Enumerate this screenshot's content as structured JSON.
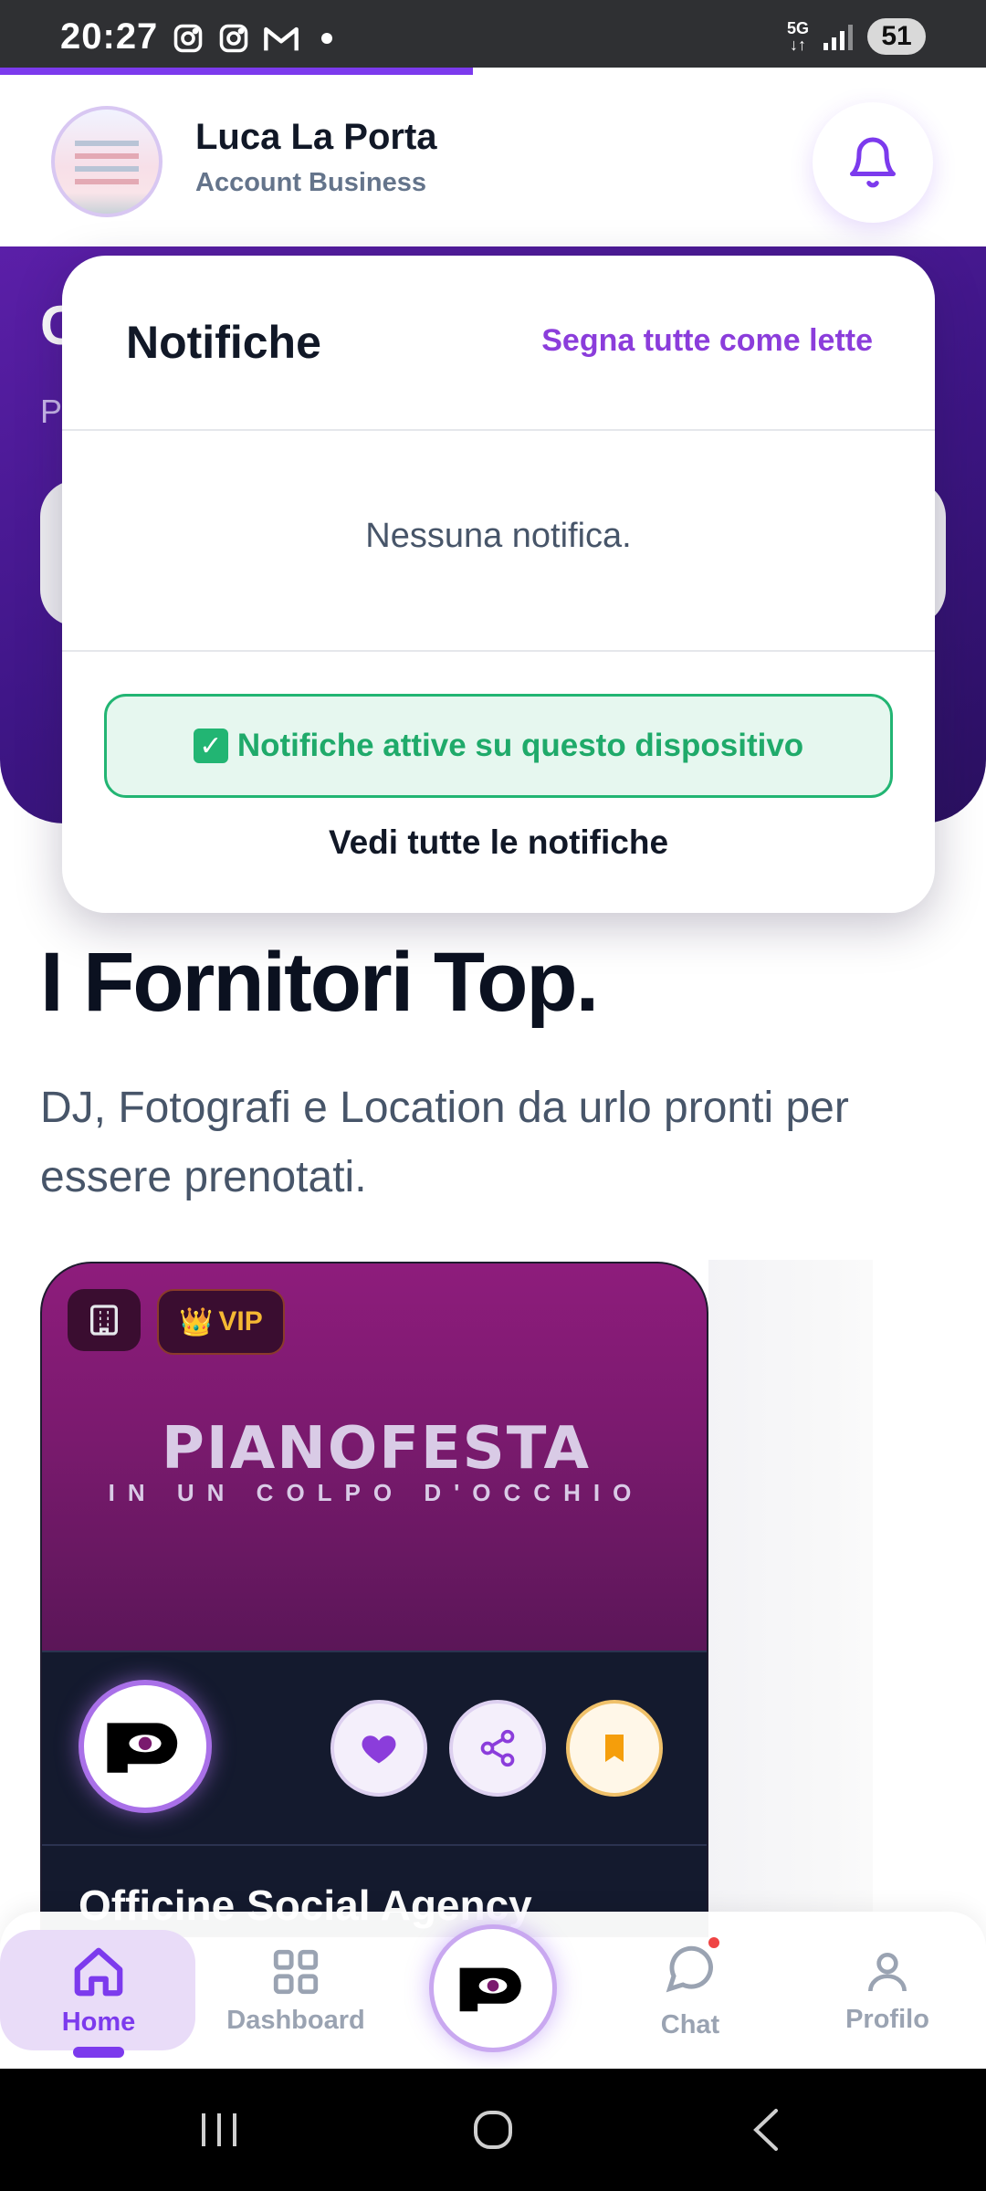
{
  "status_bar": {
    "time": "20:27",
    "network": "5G",
    "battery": "51",
    "icons": [
      "instagram-icon",
      "instagram-icon",
      "gmail-icon",
      "dot-icon",
      "signal-icon",
      "battery-icon"
    ]
  },
  "page_progress": 0.48,
  "header": {
    "name": "Luca La Porta",
    "role": "Account Business",
    "bell_icon": "bell-icon"
  },
  "notifications": {
    "title": "Notifiche",
    "mark_all": "Segna tutte come lette",
    "empty": "Nessuna notifica.",
    "active_status": "Notifiche attive su questo dispositivo",
    "see_all": "Vedi tutte le notifiche"
  },
  "section": {
    "title": "I Fornitori Top.",
    "subtitle": "DJ, Fotografi e Location da urlo pronti per essere prenotati."
  },
  "vendor_card": {
    "vip_label": "VIP",
    "brand_line1": "PIANOFESTA",
    "brand_line2": "IN UN COLPO D'OCCHIO",
    "name": "Officine Social Agency"
  },
  "bottom_nav": {
    "home": "Home",
    "dashboard": "Dashboard",
    "chat": "Chat",
    "profile": "Profilo"
  },
  "colors": {
    "accent": "#7c3aed",
    "success": "#22b573",
    "vip": "#f5b833"
  }
}
